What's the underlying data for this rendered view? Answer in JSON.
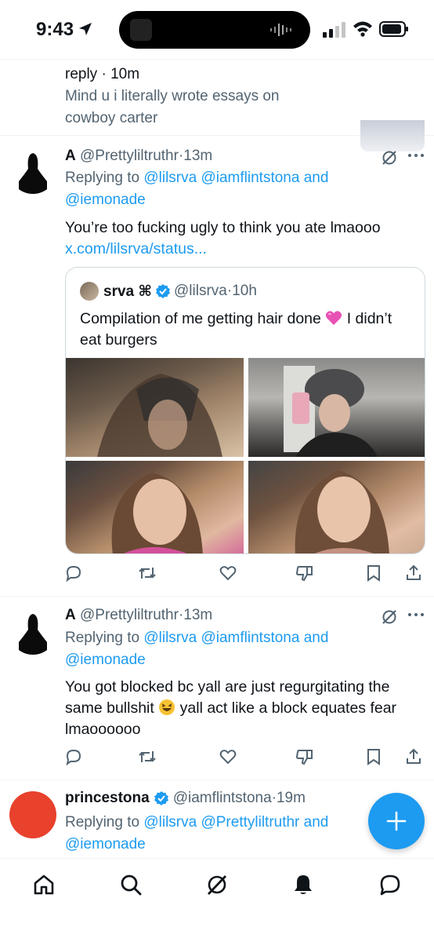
{
  "status_bar": {
    "time": "9:43"
  },
  "top_tweet": {
    "meta": "reply · 10m",
    "text": "Mind u i literally wrote essays on cowboy carter"
  },
  "tweets": [
    {
      "name": "A",
      "handle": "@Prettyliltruthr",
      "time": "13m",
      "replying_label": "Replying to",
      "mentions": "@lilsrva @iamflintstona",
      "and": "and",
      "mention_last": "@iemonade",
      "text": "You’re too fucking ugly to think you ate lmaooo",
      "link": "x.com/lilsrva/status...",
      "quote": {
        "name": "srva ⌘",
        "handle": "@lilsrva",
        "time": "10h",
        "text_before": "Compilation of me getting hair done",
        "text_after": "I didn’t eat burgers"
      }
    },
    {
      "name": "A",
      "handle": "@Prettyliltruthr",
      "time": "13m",
      "replying_label": "Replying to",
      "mentions": "@lilsrva @iamflintstona",
      "and": "and",
      "mention_last": "@iemonade",
      "text_before": "You got blocked bc yall are just regurgitating the same bullshit",
      "text_after": "yall act like a block equates fear lmaoooooo"
    },
    {
      "name": "princestona",
      "handle": "@iamflintstona",
      "time": "19m",
      "replying_label": "Replying to",
      "mentions": "@lilsrva @Prettyliltruthr",
      "and": "and",
      "mention_last": "@iemonade"
    }
  ],
  "colors": {
    "accent": "#1d9bf0",
    "secondary_text": "#536471",
    "red_avatar": "#e8412c"
  },
  "icons": [
    "location-arrow-icon",
    "signal-icon",
    "wifi-icon",
    "battery-icon",
    "grok-icon",
    "more-icon",
    "reply-icon",
    "retweet-icon",
    "like-icon",
    "dislike-icon",
    "bookmark-icon",
    "share-icon",
    "verified-icon",
    "home-icon",
    "search-icon",
    "grok-nav-icon",
    "notifications-icon",
    "messages-icon",
    "compose-plus-icon"
  ]
}
